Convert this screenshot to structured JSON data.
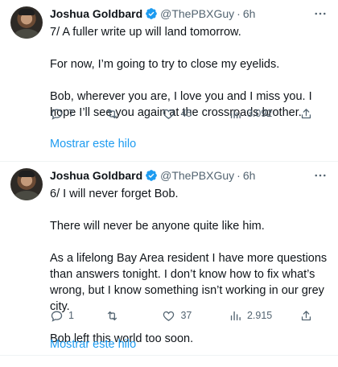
{
  "tweets": [
    {
      "author_name": "Joshua Goldbard",
      "handle": "@ThePBXGuy",
      "separator": "·",
      "time": "6h",
      "paragraphs": [
        "7/ A fuller write up will land tomorrow.",
        "For now, I’m going to try to close my eyelids.",
        "Bob, wherever you are, I love you and I miss you. I hope I’ll see you again at the crossroads brother."
      ],
      "replies": "7",
      "retweets": "",
      "likes": "45",
      "views": "3.092",
      "show_thread": "Mostrar este hilo"
    },
    {
      "author_name": "Joshua Goldbard",
      "handle": "@ThePBXGuy",
      "separator": "·",
      "time": "6h",
      "paragraphs": [
        "6/ I will never forget Bob.",
        "There will never be anyone quite like him.",
        "As a lifelong Bay Area resident I have more questions than answers tonight. I don’t know how to fix what’s wrong, but I know something isn’t working in our grey city.",
        "Bob left this world too soon."
      ],
      "replies": "1",
      "retweets": "",
      "likes": "37",
      "views": "2.915",
      "show_thread": "Mostrar este hilo"
    }
  ],
  "icons": {
    "verified": "verified-badge-icon",
    "more": "more-dots-icon",
    "reply": "reply-icon",
    "retweet": "retweet-icon",
    "like": "heart-icon",
    "views": "views-chart-icon",
    "share": "share-icon"
  },
  "colors": {
    "link": "#1d9bf0",
    "muted": "#536471",
    "text": "#0f1419",
    "divider": "#eff3f4"
  }
}
